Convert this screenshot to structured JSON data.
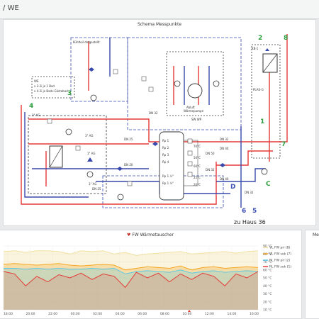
{
  "breadcrumb": {
    "app": "",
    "separator": "/",
    "page": "WE"
  },
  "schema_panel": {
    "title": "Schema Messpunkte",
    "labels": {
      "kuehlteil": "Kühlteil dargestellt",
      "we_box": [
        "WE",
        "x 2-2i je 1 Bad",
        "x 4-2i je Bad+Gästebad"
      ],
      "abluft": [
        "Abluft",
        "Wärmepumpe"
      ],
      "sw_wp": "SW WP",
      "kb": "KB-1",
      "plas": "PLAS-G",
      "haus": "zu Haus 36",
      "pipes": {
        "dn32_top": "DN 32",
        "dn25_a": "DN 25",
        "dn20": "DN 20",
        "dn25_b": "DN 25",
        "dn40_a": "DN 40",
        "dn32_b": "DN 32",
        "dn40_b": "DN 40",
        "dn32_c": "DN 32",
        "dn50": "DN 50",
        "dn32_d": "DN 32"
      },
      "storage_labels": [
        "Rp 1",
        "Rp 2",
        "Rp 3",
        "Rp 4",
        "Rp 1 ½\"",
        "Rp 1 ¼\""
      ],
      "temp_labels": [
        "70°C",
        "50°C",
        "60°C",
        "25°C",
        "20°C"
      ],
      "ag": "1\" AG",
      "cold_marks": [
        "3\" AG",
        "1\" AG"
      ]
    },
    "markers": {
      "green": [
        "2",
        "8",
        "3",
        "4",
        "1",
        "7",
        "C"
      ],
      "blue": [
        "D",
        "6",
        "5"
      ]
    },
    "colors": {
      "supply": "#e53935",
      "return": "#3949ab",
      "green": "#2e9d3e",
      "blue": "#3f51b5"
    }
  },
  "chart_panel": {
    "title": "FW Wärmetauscher",
    "heart_icon": "heart-icon",
    "chart_data": {
      "type": "line",
      "title": "FW Wärmetauscher",
      "xlabel": "",
      "ylabel": "",
      "x": [
        "18:00",
        "20:00",
        "22:00",
        "00:00",
        "02:00",
        "04:00",
        "06:00",
        "08:00",
        "10:00",
        "12:00",
        "14:00",
        "16:00"
      ],
      "yticks": [
        "90 °C",
        "80 °C",
        "70 °C",
        "60 °C",
        "50 °C",
        "40 °C",
        "30 °C",
        "20 °C",
        "10 °C"
      ],
      "ylim": [
        10,
        90
      ],
      "grid": true,
      "legend_position": "right",
      "series": [
        {
          "name": "VL FW pri (8)",
          "color": "#f0e0a0",
          "values": [
            83,
            84,
            82,
            84,
            84,
            83,
            80,
            84,
            83,
            84,
            80,
            82,
            78,
            80,
            81,
            82,
            83,
            80,
            81,
            82,
            83,
            81,
            83,
            84
          ]
        },
        {
          "name": "VL FW sek (7)",
          "color": "#f5a623",
          "values": [
            67,
            68,
            67,
            66,
            67,
            68,
            66,
            65,
            66,
            67,
            66,
            60,
            62,
            64,
            63,
            62,
            65,
            60,
            63,
            64,
            62,
            63,
            64,
            63
          ]
        },
        {
          "name": "RL FW pri (2)",
          "color": "#5bc8e8",
          "values": [
            62,
            62,
            61,
            62,
            61,
            62,
            61,
            61,
            62,
            61,
            62,
            55,
            58,
            59,
            58,
            57,
            60,
            56,
            58,
            59,
            57,
            58,
            59,
            58
          ]
        },
        {
          "name": "RL FW sek (1)",
          "color": "#e53935",
          "values": [
            58,
            55,
            40,
            52,
            45,
            54,
            50,
            56,
            48,
            55,
            52,
            38,
            57,
            50,
            56,
            45,
            55,
            48,
            56,
            52,
            40,
            55,
            50,
            58
          ]
        }
      ]
    }
  },
  "right_panel": {
    "title_fragment": "Me"
  }
}
